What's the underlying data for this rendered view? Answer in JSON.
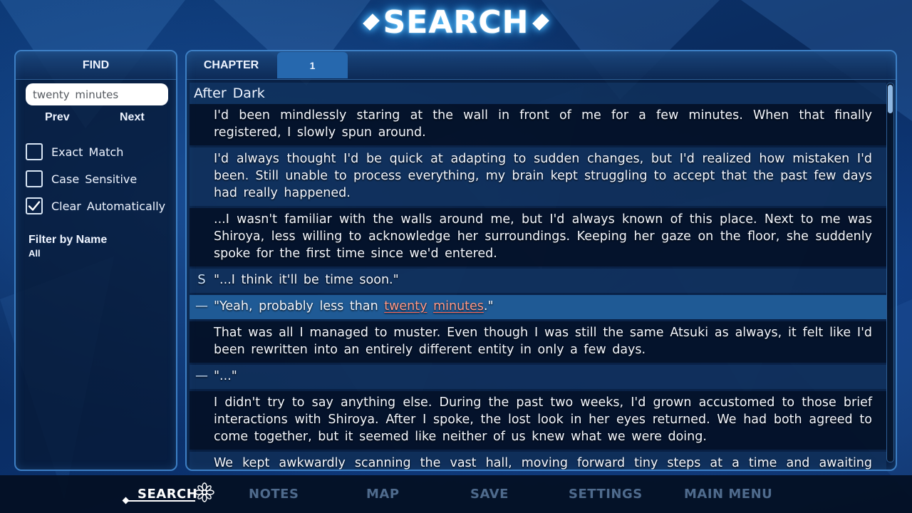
{
  "screen_title": "SEARCH",
  "find_panel": {
    "header": "FIND",
    "search_value": "twenty minutes",
    "prev_label": "Prev",
    "next_label": "Next",
    "options": [
      {
        "label": "Exact Match",
        "checked": false
      },
      {
        "label": "Case Sensitive",
        "checked": false
      },
      {
        "label": "Clear Automatically",
        "checked": true
      }
    ],
    "filter_label": "Filter by Name",
    "filter_value": "All"
  },
  "log_panel": {
    "chapter_tab": "CHAPTER",
    "chapter_number": "1",
    "heading": "After Dark",
    "entries": [
      {
        "speaker": "",
        "text": "I'd been mindlessly staring at the wall in front of me for a few minutes. When that finally registered, I slowly spun around."
      },
      {
        "speaker": "",
        "text": "I'd always thought I'd be quick at adapting to sudden changes, but I'd realized how mistaken I'd been. Still unable to process everything, my brain kept struggling to accept that the past few days had really happened."
      },
      {
        "speaker": "",
        "text": "...I wasn't familiar with the walls around me, but I'd always known of this place. Next to me was Shiroya, less willing to acknowledge her surroundings. Keeping her gaze on the floor, she suddenly spoke for the first time since we'd entered."
      },
      {
        "speaker": "S",
        "text": "\"...I think it'll be time soon.\""
      },
      {
        "speaker": "—",
        "text_before": "\"Yeah, probably less than ",
        "match_1": "twenty",
        "text_mid": " ",
        "match_2": "minutes",
        "text_after": ".\""
      },
      {
        "speaker": "",
        "text": "That was all I managed to muster. Even though I was still the same Atsuki as always, it felt like I'd been rewritten into an entirely different entity in only a few days."
      },
      {
        "speaker": "—",
        "text": "\"...\""
      },
      {
        "speaker": "",
        "text": "I didn't try to say anything else. During the past two weeks, I'd grown accustomed to those brief interactions with Shiroya. After I spoke, the lost look in her eyes returned. We had both agreed to come together, but it seemed like neither of us knew what we were doing."
      },
      {
        "speaker": "",
        "text": "We kept awkwardly scanning the vast hall, moving forward tiny steps at a time and awaiting further"
      }
    ],
    "scroll_position": 0.0
  },
  "nav": {
    "items": [
      "SEARCH",
      "NOTES",
      "MAP",
      "SAVE",
      "SETTINGS",
      "MAIN MENU"
    ],
    "active": "SEARCH",
    "active_icon": "flower-icon"
  },
  "colors": {
    "accent": "#2668ae",
    "highlight_row": "#1f5a95",
    "match_text": "#ff9a8a",
    "nav_inactive": "#4f6b8d"
  }
}
